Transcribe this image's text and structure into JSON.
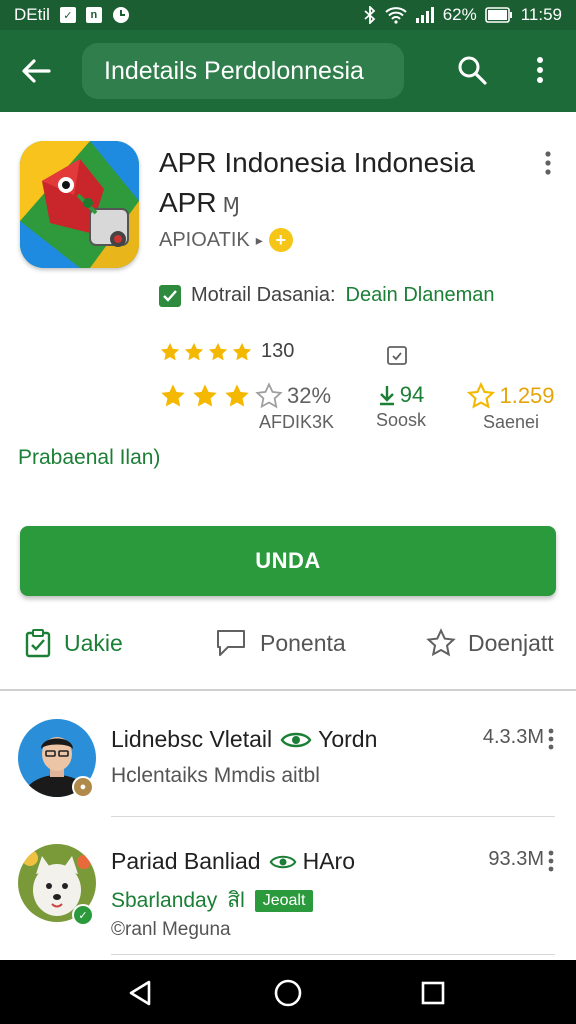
{
  "status_bar": {
    "carrier": "DEtil",
    "battery": "62%",
    "time": "11:59"
  },
  "toolbar": {
    "search_text": "Indetails Perdolonnesia"
  },
  "app": {
    "title": "APR Indonesia Indonesia APR",
    "title_suffix": "Ɱ",
    "developer": "APIOATIK",
    "developer_badge": "+",
    "verified_label": "Motrail Dasania:",
    "verified_green": "Deain Dlaneman",
    "rating_count": "130",
    "stats": {
      "rating_value": "32%",
      "rating_label": "AFDIK3K",
      "downloads_value": "94",
      "downloads_label": "Soosk",
      "reviews_value": "1.259",
      "reviews_label": "Saenei"
    },
    "pre_register": "Prabaenal Ilan)",
    "install_label": "UNDA"
  },
  "actions": [
    {
      "label": "Uakie",
      "icon": "clipboard-check-icon"
    },
    {
      "label": "Ponenta",
      "icon": "chat-bubble-icon"
    },
    {
      "label": "Doenjatt",
      "icon": "star-outline-icon"
    }
  ],
  "items": [
    {
      "name": "Lidnebsc Vletail",
      "tag_icon": "eye-icon",
      "tag_after": "Yordn",
      "subtitle": "Hclentaiks Mmdis aitbl",
      "size": "4.3.3M"
    },
    {
      "name": "Pariad Banliad",
      "tag_icon": "eye-icon",
      "tag_after": "HAro",
      "subtitle": "Sbarlanday",
      "subtitle_mark": "สิl",
      "chip": "Jeoalt",
      "extra": "©ranl Meguna",
      "size": "93.3M"
    }
  ],
  "colors": {
    "status_bar": "#1b5e32",
    "toolbar": "#1e6b3a",
    "accent_green": "#2b9a3d",
    "star_gold": "#f5b800"
  }
}
